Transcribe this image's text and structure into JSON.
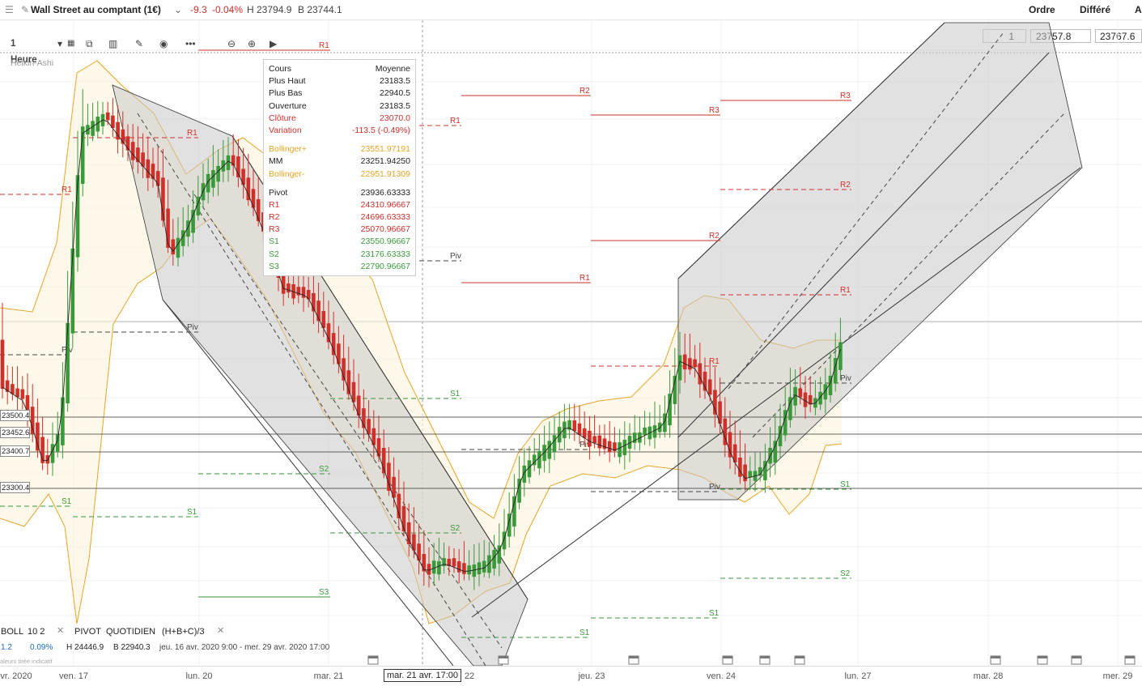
{
  "header": {
    "instrument": "Wall Street au comptant (1€)",
    "change": "-9.3",
    "change_pct": "-0.04%",
    "high_label": "H 23794.9",
    "low_label": "B 23744.1",
    "ordre": "Ordre",
    "differe": "Différé",
    "a_label": "A",
    "qty": "1",
    "bid": "23757.8",
    "ask": "23767.6"
  },
  "toolbar": {
    "interval": "1 Heure",
    "chart_style": "Heikin-Ashi"
  },
  "tooltip": {
    "cours_label": "Cours",
    "cours_value": "Moyenne",
    "rows": [
      {
        "label": "Plus Haut",
        "value": "23183.5",
        "color": "#222222"
      },
      {
        "label": "Plus Bas",
        "value": "22940.5",
        "color": "#222222"
      },
      {
        "label": "Ouverture",
        "value": "23183.5",
        "color": "#222222"
      },
      {
        "label": "Clôture",
        "value": "23070.0",
        "color": "#d0302a"
      },
      {
        "label": "Variation",
        "value": "-113.5 (-0.49%)",
        "color": "#d0302a"
      }
    ],
    "boll_rows": [
      {
        "label": "Bollinger+",
        "value": "23551.97191",
        "color": "#e7a526"
      },
      {
        "label": "MM",
        "value": "23251.94250",
        "color": "#222222"
      },
      {
        "label": "Bollinger-",
        "value": "22951.91309",
        "color": "#e7a526"
      }
    ],
    "pivot_rows": [
      {
        "label": "Pivot",
        "value": "23936.63333",
        "color": "#222222"
      },
      {
        "label": "R1",
        "value": "24310.96667",
        "color": "#d0302a"
      },
      {
        "label": "R2",
        "value": "24696.63333",
        "color": "#d0302a"
      },
      {
        "label": "R3",
        "value": "25070.96667",
        "color": "#d0302a"
      },
      {
        "label": "S1",
        "value": "23550.96667",
        "color": "#3a9a3a"
      },
      {
        "label": "S2",
        "value": "23176.63333",
        "color": "#3a9a3a"
      },
      {
        "label": "S3",
        "value": "22790.96667",
        "color": "#3a9a3a"
      }
    ]
  },
  "indicators": {
    "boll_name": "BOLL",
    "boll_params": "10  2",
    "pivot_name": "PIVOT",
    "pivot_mode": "QUOTIDIEN",
    "pivot_formula": "(H+B+C)/3",
    "summary_change": "1.2",
    "summary_pct": "0.09%",
    "summary_high": "H 24446.9",
    "summary_low": "B 22940.3",
    "summary_range": "jeu. 16 avr. 2020 9:00 - mer. 29 avr. 2020 17:00",
    "footnote": "aleurs tirée indicatif"
  },
  "price_tags": [
    "23500.4",
    "23452.6",
    "23400.7",
    "23300.4"
  ],
  "colors": {
    "up": "#3a9a3a",
    "down": "#d0302a",
    "bollinger": "#e7a526",
    "pivot": "#444444",
    "channel": "#c8c8c8"
  },
  "chart_data": {
    "type": "candlestick",
    "title": "Wall Street au comptant (1€)",
    "interval": "1 Heure",
    "style": "Heikin-Ashi",
    "x_labels": [
      "vr. 2020",
      "ven. 17",
      "lun. 20",
      "mar. 21",
      "mar. 21 avr. 17:00",
      "22",
      "jeu. 23",
      "ven. 24",
      "lun. 27",
      "mar. 28",
      "mer. 29"
    ],
    "horizontal_levels": [
      23500.4,
      23452.6,
      23400.7,
      23300.4
    ],
    "pivot_labels": [
      "Piv",
      "R1",
      "R2",
      "R3",
      "S1",
      "S2",
      "S3"
    ]
  }
}
